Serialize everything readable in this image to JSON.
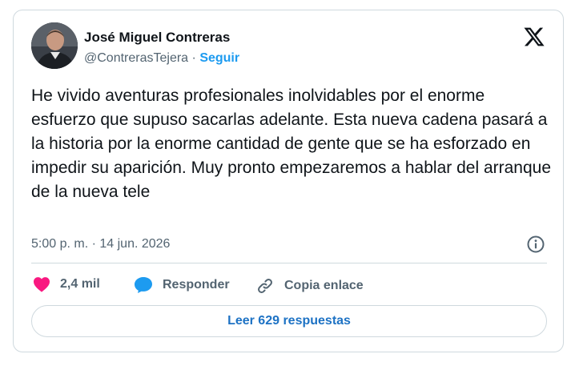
{
  "author": {
    "name": "José Miguel Contreras",
    "handle": "@ContrerasTejera",
    "separator": "·",
    "follow_label": "Seguir"
  },
  "tweet": {
    "text": "He vivido aventuras profesionales inolvidables por el enorme esfuerzo que supuso sacarlas adelante. Esta nueva cadena pasará a la historia por la enorme cantidad de gente que se ha esforzado en impedir su aparición. Muy pronto empezaremos a hablar del arranque de la nueva tele",
    "timestamp": "5:00 p. m. · 14 jun. 2026"
  },
  "actions": {
    "likes_count": "2,4 mil",
    "reply_label": "Responder",
    "copy_link_label": "Copia enlace"
  },
  "replies_button_label": "Leer 629 respuestas",
  "icons": {
    "logo": "x-logo-icon",
    "info": "info-icon",
    "like": "heart-icon",
    "reply": "speech-bubble-icon",
    "copy": "link-icon"
  },
  "colors": {
    "accent": "#1d9bf0",
    "heart": "#f91880",
    "text": "#0f1419",
    "muted": "#536471",
    "border": "#cfd9de"
  }
}
